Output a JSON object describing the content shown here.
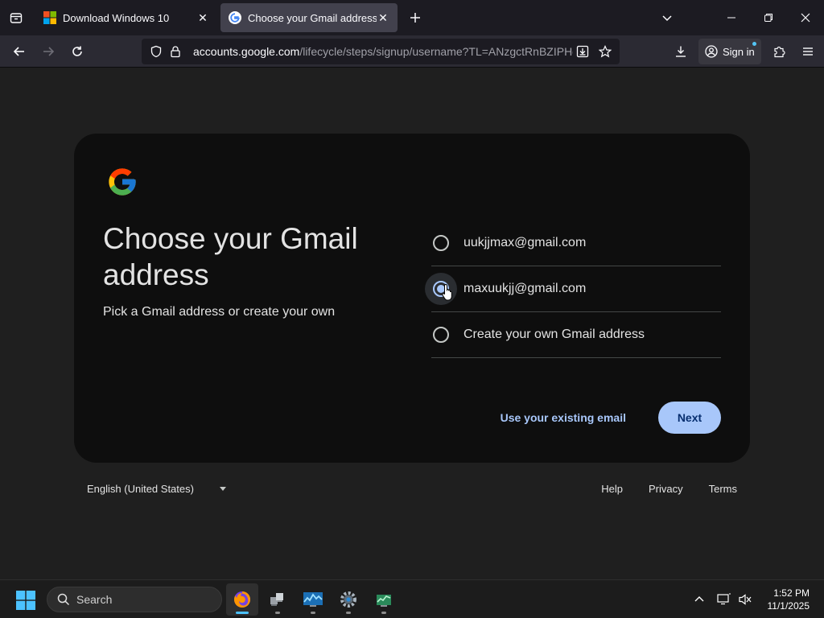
{
  "browser": {
    "tabs": [
      {
        "title": "Download Windows 10",
        "favicon": "windows-logo-icon",
        "active": false
      },
      {
        "title": "Choose your Gmail address Pick",
        "favicon": "google-g-icon",
        "active": true
      }
    ],
    "url_host": "accounts.google.com",
    "url_path": "/lifecycle/steps/signup/username?TL=ANzgctRnBZIPHq",
    "signin_label": "Sign in"
  },
  "page": {
    "heading": "Choose your Gmail address",
    "subheading": "Pick a Gmail address or create your own",
    "options": [
      {
        "label": "uukjjmax@gmail.com",
        "checked": false
      },
      {
        "label": "maxuukjj@gmail.com",
        "checked": true
      },
      {
        "label": "Create your own Gmail address",
        "checked": false
      }
    ],
    "existing_email_label": "Use your existing email",
    "next_label": "Next"
  },
  "footer": {
    "language": "English (United States)",
    "links": [
      "Help",
      "Privacy",
      "Terms"
    ]
  },
  "taskbar": {
    "search_label": "Search",
    "time": "1:52 PM",
    "date": "11/1/2025"
  },
  "colors": {
    "accent": "#a8c7fa",
    "card_bg": "#0e0e0e",
    "page_bg": "#1f1f1f"
  }
}
